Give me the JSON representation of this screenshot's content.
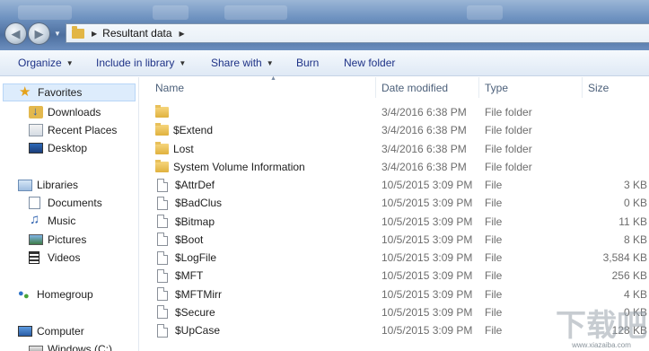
{
  "address": {
    "path_label": "Resultant data"
  },
  "toolbar": {
    "organize": "Organize",
    "include_in_library": "Include in library",
    "share_with": "Share with",
    "burn": "Burn",
    "new_folder": "New folder"
  },
  "nav": {
    "favorites": "Favorites",
    "downloads": "Downloads",
    "recent_places": "Recent Places",
    "desktop": "Desktop",
    "libraries": "Libraries",
    "documents": "Documents",
    "music": "Music",
    "pictures": "Pictures",
    "videos": "Videos",
    "homegroup": "Homegroup",
    "computer": "Computer",
    "drive": "Windows (C:)"
  },
  "columns": {
    "name": "Name",
    "date_modified": "Date modified",
    "type": "Type",
    "size": "Size"
  },
  "files": [
    {
      "name": "",
      "date": "3/4/2016 6:38 PM",
      "type": "File folder",
      "size": "",
      "icon": "folder-icon"
    },
    {
      "name": "$Extend",
      "date": "3/4/2016 6:38 PM",
      "type": "File folder",
      "size": "",
      "icon": "folder-icon"
    },
    {
      "name": "Lost",
      "date": "3/4/2016 6:38 PM",
      "type": "File folder",
      "size": "",
      "icon": "folder-icon"
    },
    {
      "name": "System Volume Information",
      "date": "3/4/2016 6:38 PM",
      "type": "File folder",
      "size": "",
      "icon": "folder-icon"
    },
    {
      "name": "$AttrDef",
      "date": "10/5/2015 3:09 PM",
      "type": "File",
      "size": "3 KB",
      "icon": "file-icon"
    },
    {
      "name": "$BadClus",
      "date": "10/5/2015 3:09 PM",
      "type": "File",
      "size": "0 KB",
      "icon": "file-icon"
    },
    {
      "name": "$Bitmap",
      "date": "10/5/2015 3:09 PM",
      "type": "File",
      "size": "11 KB",
      "icon": "file-icon"
    },
    {
      "name": "$Boot",
      "date": "10/5/2015 3:09 PM",
      "type": "File",
      "size": "8 KB",
      "icon": "file-icon"
    },
    {
      "name": "$LogFile",
      "date": "10/5/2015 3:09 PM",
      "type": "File",
      "size": "3,584 KB",
      "icon": "file-icon"
    },
    {
      "name": "$MFT",
      "date": "10/5/2015 3:09 PM",
      "type": "File",
      "size": "256 KB",
      "icon": "file-icon"
    },
    {
      "name": "$MFTMirr",
      "date": "10/5/2015 3:09 PM",
      "type": "File",
      "size": "4 KB",
      "icon": "file-icon"
    },
    {
      "name": "$Secure",
      "date": "10/5/2015 3:09 PM",
      "type": "File",
      "size": "0 KB",
      "icon": "file-icon"
    },
    {
      "name": "$UpCase",
      "date": "10/5/2015 3:09 PM",
      "type": "File",
      "size": "128 KB",
      "icon": "file-icon"
    }
  ],
  "watermark": {
    "logo": "下载吧",
    "url": "www.xiazaiba.com"
  }
}
